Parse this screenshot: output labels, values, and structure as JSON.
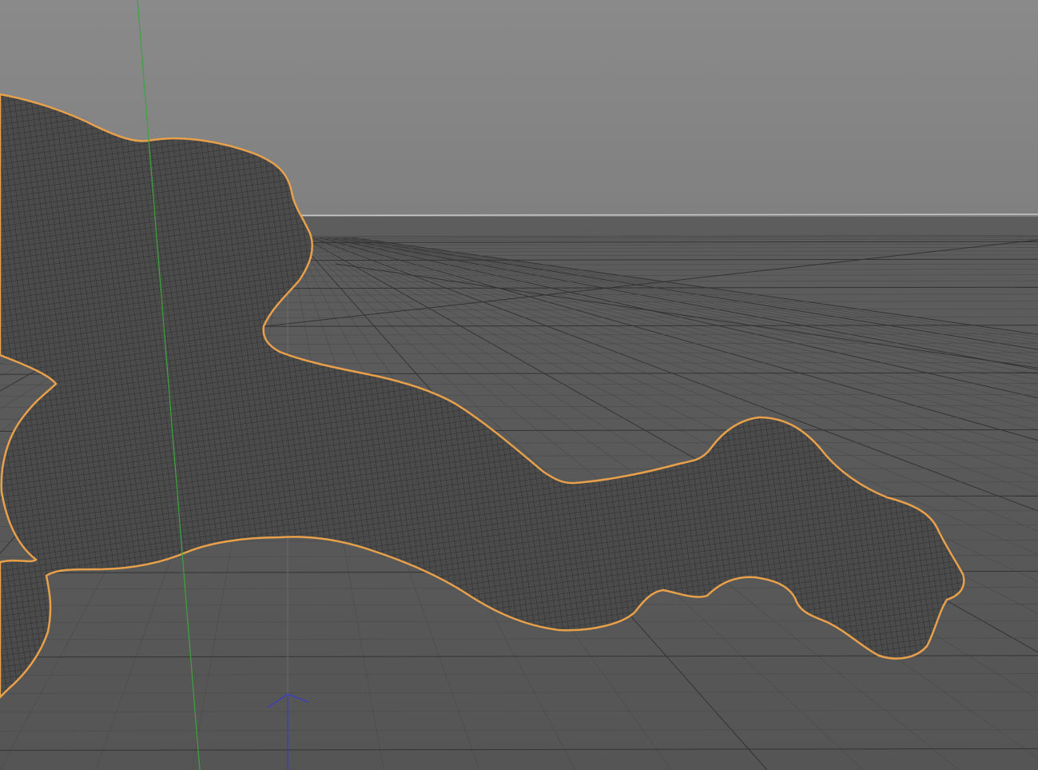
{
  "viewport": {
    "view": "perspective",
    "colors": {
      "sky_top": "#8a8a8a",
      "sky_bottom": "#808080",
      "floor_far": "#5d5d5d",
      "floor_near": "#555555",
      "grid_minor": "#4a4a4a",
      "grid_major": "#333333",
      "horizon_line": "#c8c8c8",
      "mesh_fill": "#4b4b4b",
      "mesh_wire": "#262626",
      "selection_outline": "#e8a04a",
      "y_axis": "#3aa53a",
      "z_axis": "#3a3ad2",
      "origin_line": "#6a6a6a"
    },
    "grid_visible": true,
    "selected_object": "sculpted-mesh",
    "axes": [
      "y-axis",
      "z-axis-arrow"
    ]
  }
}
